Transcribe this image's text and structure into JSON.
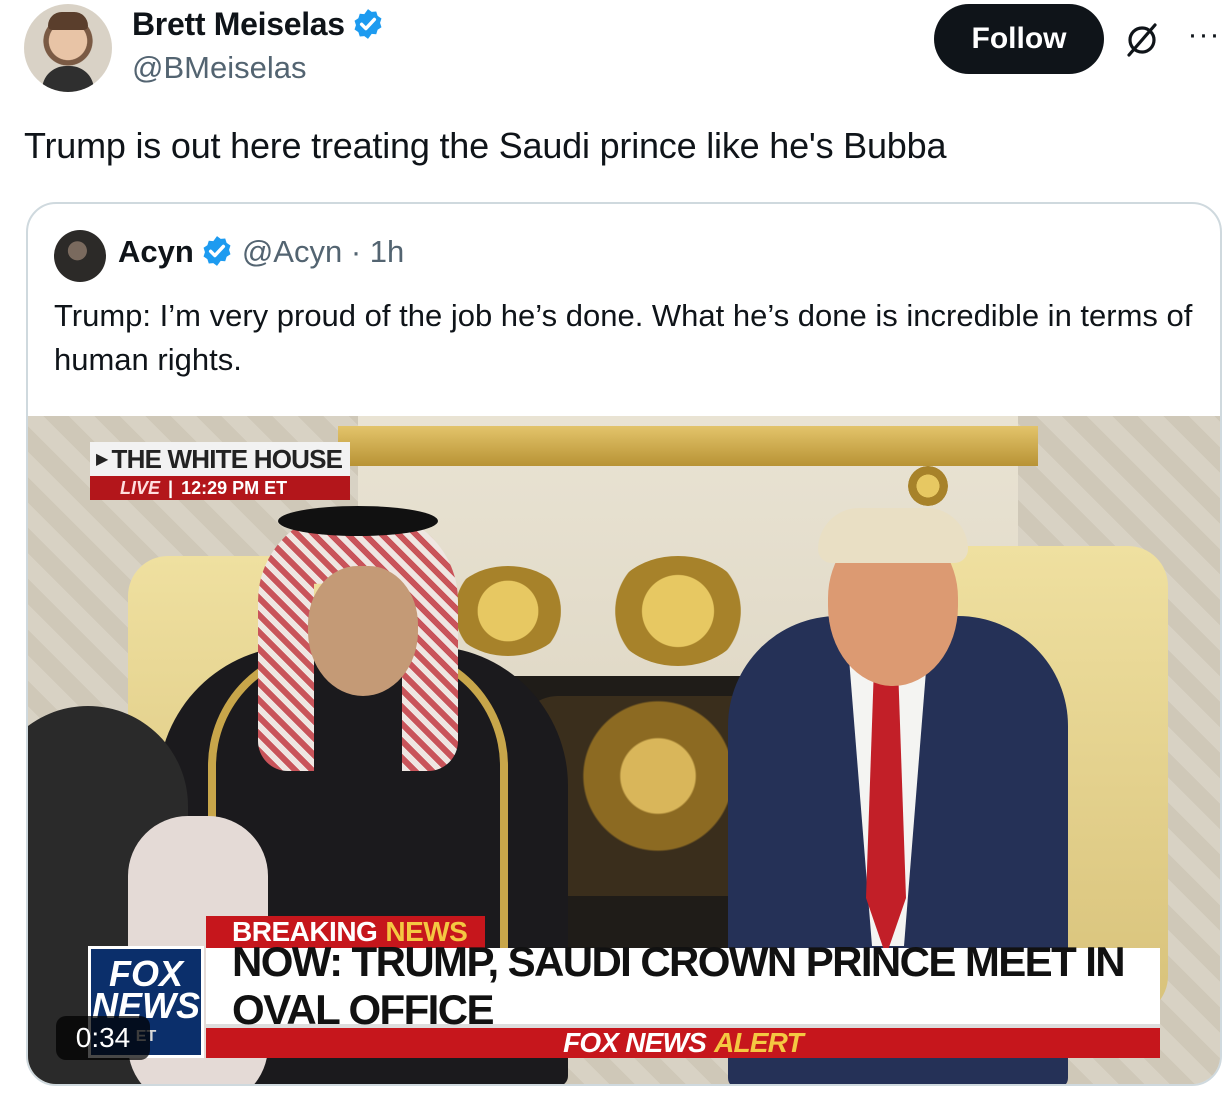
{
  "post": {
    "author_name": "Brett Meiselas",
    "author_handle": "@BMeiselas",
    "follow_label": "Follow",
    "more_label": "···",
    "text": "Trump is out here treating the Saudi prince like he's Bubba"
  },
  "quoted": {
    "author_name": "Acyn",
    "author_handle": "@Acyn",
    "separator": "·",
    "time": "1h",
    "text": "Trump: I’m very proud of the job he’s done. What he’s done is incredible in terms of human rights."
  },
  "video": {
    "duration": "0:34",
    "chyron_location": "THE WHITE HOUSE",
    "chyron_live": "LIVE",
    "chyron_time": "12:29 PM ET",
    "breaking_label": "BREAKING",
    "breaking_news": "NEWS",
    "headline": "NOW: TRUMP, SAUDI CROWN PRINCE MEET IN OVAL OFFICE",
    "alert_brand": "FOX NEWS",
    "alert_label": "ALERT",
    "logo_top": "FOX",
    "logo_bottom": "NEWS",
    "logo_sub": "ET"
  },
  "colors": {
    "verified_blue": "#1d9bf0",
    "follow_bg": "#0f1419",
    "fox_red": "#c6161c",
    "fox_gold": "#f4c842"
  }
}
